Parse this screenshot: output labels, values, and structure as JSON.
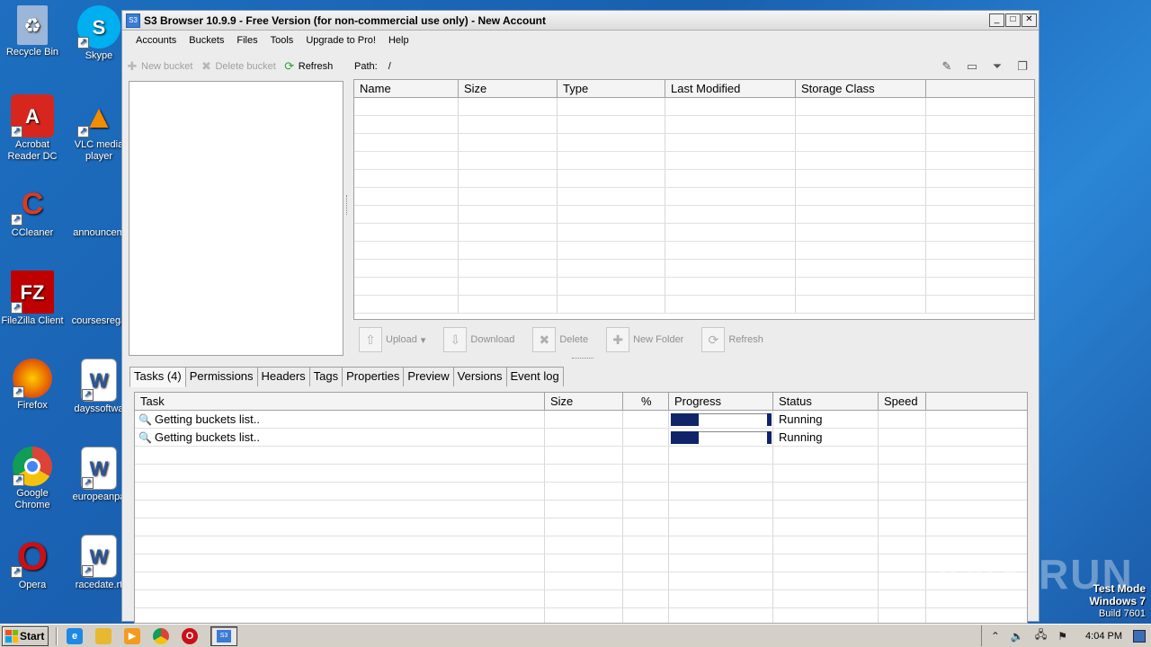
{
  "desktop": {
    "icons": [
      {
        "label": "Recycle Bin",
        "icon": "recycle-bin-icon",
        "color": "#6f95c9"
      },
      {
        "label": "Skype",
        "icon": "skype-icon",
        "color": "#00aff0"
      },
      {
        "label_line1": "Acrobat",
        "label_line2": "Reader DC",
        "icon": "acrobat-icon",
        "color": "#d7261e"
      },
      {
        "label_line1": "VLC media",
        "label_line2": "player",
        "icon": "vlc-icon",
        "color": "#f28c00"
      },
      {
        "label": "CCleaner",
        "icon": "ccleaner-icon",
        "color": "#d33d2b"
      },
      {
        "label": "announcem",
        "icon": "blank-file-icon",
        "color": "#1a5fb0"
      },
      {
        "label": "FileZilla Client",
        "icon": "filezilla-icon",
        "color": "#bf0000"
      },
      {
        "label": "coursesrega",
        "icon": "blank-file-icon",
        "color": "#1a5fb0"
      },
      {
        "label": "Firefox",
        "icon": "firefox-icon",
        "color": "#e66000"
      },
      {
        "label": "dayssoftwa",
        "icon": "word-doc-icon",
        "color": "#2b579a"
      },
      {
        "label_line1": "Google",
        "label_line2": "Chrome",
        "icon": "chrome-icon",
        "color": "#2a9d4a"
      },
      {
        "label": "europeanpa",
        "icon": "word-doc-icon",
        "color": "#2b579a"
      },
      {
        "label": "Opera",
        "icon": "opera-icon",
        "color": "#cc0f16"
      },
      {
        "label": "racedate.rt",
        "icon": "word-doc-icon",
        "color": "#2b579a"
      }
    ]
  },
  "window": {
    "app_icon_text": "S3",
    "title": "S3 Browser 10.9.9 - Free Version (for non-commercial use only) - New Account",
    "buttons": {
      "minimize": "_",
      "maximize": "□",
      "close": "✕"
    }
  },
  "menu": [
    "Accounts",
    "Buckets",
    "Files",
    "Tools",
    "Upgrade to Pro!",
    "Help"
  ],
  "left_toolbar": {
    "new_bucket": "New bucket",
    "delete_bucket": "Delete bucket",
    "refresh": "Refresh"
  },
  "path": {
    "label": "Path:",
    "value": "/"
  },
  "file_grid": {
    "columns": [
      "Name",
      "Size",
      "Type",
      "Last Modified",
      "Storage Class"
    ],
    "empty_rows": 12
  },
  "file_toolbar": {
    "upload": "Upload",
    "upload_arrow": "▾",
    "download": "Download",
    "delete": "Delete",
    "new_folder": "New Folder",
    "refresh": "Refresh"
  },
  "tabs": [
    "Tasks (4)",
    "Permissions",
    "Headers",
    "Tags",
    "Properties",
    "Preview",
    "Versions",
    "Event log"
  ],
  "task_grid": {
    "columns": [
      "Task",
      "Size",
      "%",
      "Progress",
      "Status",
      "Speed"
    ],
    "rows": [
      {
        "task": "Getting buckets list..",
        "size": "",
        "percent": "",
        "progress": 0.28,
        "status": "Running",
        "speed": ""
      },
      {
        "task": "Getting buckets list..",
        "size": "",
        "percent": "",
        "progress": 0.28,
        "status": "Running",
        "speed": ""
      }
    ],
    "empty_rows": 10
  },
  "watermark": "ANY RUN",
  "testmode": {
    "line1": "Test Mode",
    "line2": "Windows 7",
    "line3": "Build 7601"
  },
  "taskbar": {
    "start": "Start",
    "clock": "4:04 PM",
    "running_app_icon_text": "S3"
  }
}
